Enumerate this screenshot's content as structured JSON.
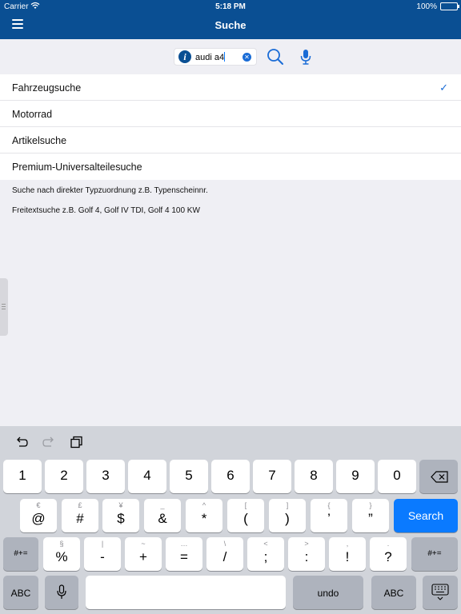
{
  "status_bar": {
    "carrier": "Carrier",
    "time": "5:18 PM",
    "battery": "100%"
  },
  "nav": {
    "title": "Suche",
    "menu_icon": "hamburger-icon"
  },
  "search": {
    "info_icon": "info-icon",
    "info_glyph": "i",
    "value": "audi a4",
    "clear_icon": "clear-icon",
    "search_icon": "search-icon",
    "mic_icon": "microphone-icon"
  },
  "list": {
    "items": [
      {
        "label": "Fahrzeugsuche",
        "selected": true
      },
      {
        "label": "Motorrad",
        "selected": false
      },
      {
        "label": "Artikelsuche",
        "selected": false
      },
      {
        "label": "Premium-Universalteilesuche",
        "selected": false
      }
    ],
    "checkmark": "✓"
  },
  "hints": {
    "line1": "Suche nach direkter Typzuordnung z.B. Typenscheinnr.",
    "line2": "Freitextsuche z.B. Golf 4, Golf IV TDI, Golf 4 100 KW"
  },
  "keyboard": {
    "toolbar": [
      "undo-icon",
      "redo-icon",
      "paste-icon"
    ],
    "row1": [
      "1",
      "2",
      "3",
      "4",
      "5",
      "6",
      "7",
      "8",
      "9",
      "0"
    ],
    "backspace_icon": "backspace-icon",
    "row2": [
      {
        "main": "@",
        "alt": "€"
      },
      {
        "main": "#",
        "alt": "£"
      },
      {
        "main": "$",
        "alt": "¥"
      },
      {
        "main": "&",
        "alt": "_"
      },
      {
        "main": "*",
        "alt": "^"
      },
      {
        "main": "(",
        "alt": "["
      },
      {
        "main": ")",
        "alt": "]"
      },
      {
        "main": "’",
        "alt": "{"
      },
      {
        "main": "”",
        "alt": "}"
      }
    ],
    "search_label": "Search",
    "shift_label": "#+=",
    "row3": [
      {
        "main": "%",
        "alt": "§"
      },
      {
        "main": "-",
        "alt": "|"
      },
      {
        "main": "+",
        "alt": "~"
      },
      {
        "main": "=",
        "alt": "…"
      },
      {
        "main": "/",
        "alt": "\\"
      },
      {
        "main": ";",
        "alt": "<"
      },
      {
        "main": ":",
        "alt": ">"
      },
      {
        "main": "!",
        "alt": ","
      },
      {
        "main": "?",
        "alt": "."
      }
    ],
    "abc_label": "ABC",
    "undo_label": "undo",
    "mic_icon": "microphone-icon",
    "dismiss_icon": "keyboard-dismiss-icon"
  },
  "colors": {
    "brand": "#0a4f93",
    "accent": "#0a7aff"
  }
}
